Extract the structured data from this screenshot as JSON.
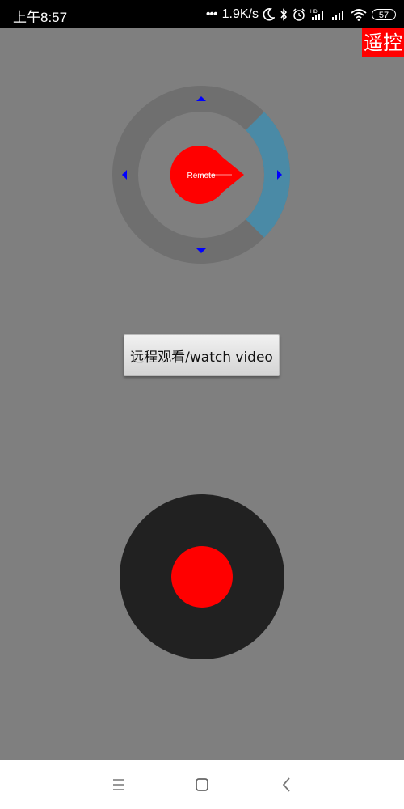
{
  "status_bar": {
    "time": "上午8:57",
    "net_speed": "1.9K/s",
    "battery": "57",
    "icons": [
      "dots-icon",
      "moon-icon",
      "bluetooth-icon",
      "alarm-icon",
      "signal-hd-icon",
      "signal-icon",
      "wifi-icon",
      "battery-icon"
    ]
  },
  "mode_button": {
    "label": "遥控"
  },
  "wheel": {
    "center_label": "Remote",
    "arrows": [
      "up-arrow-icon",
      "down-arrow-icon",
      "left-arrow-icon",
      "right-arrow-icon"
    ],
    "active_direction": "right",
    "colors": {
      "ring": "#6f6f6f",
      "highlight": "#4a8aa6",
      "center": "#ff0000",
      "arrow": "#0000ff"
    }
  },
  "watch_button": {
    "label": "远程观看/watch video"
  },
  "joystick": {
    "colors": {
      "base": "#212121",
      "knob": "#ff0000"
    }
  },
  "nav_bar": {
    "icons": [
      "menu-icon",
      "home-icon",
      "back-icon"
    ]
  }
}
